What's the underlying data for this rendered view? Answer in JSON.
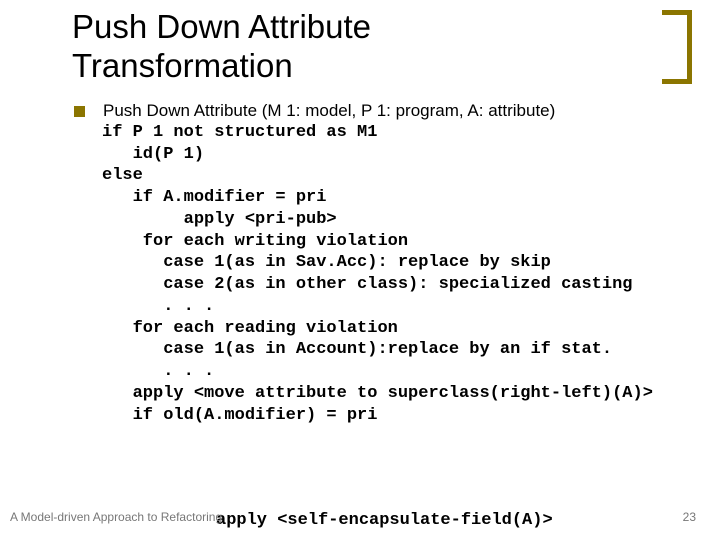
{
  "title_l1": "Push Down Attribute",
  "title_l2": "Transformation",
  "sig": "Push Down Attribute (M 1: model, P 1: program, A: attribute)",
  "c1": "if P 1 not structured as M1",
  "c2": "   id(P 1)",
  "c3": "else",
  "c4": "   if A.modifier = pri",
  "c5": "        apply <pri-pub>",
  "c6": "    for each writing violation",
  "c7": "      case 1(as in Sav.Acc): replace by skip",
  "c8": "      case 2(as in other class): specialized casting",
  "c9": "      . . .",
  "c10": "   for each reading violation",
  "c11": "      case 1(as in Account):replace by an if stat.",
  "c12": "      . . .",
  "c13": "   apply <move attribute to superclass(right-left)(A)>",
  "c14": "   if old(A.modifier) = pri",
  "last": "apply <self-encapsulate-field(A)>",
  "footer_text": "A Model-driven Approach to Refactoring",
  "page": "23"
}
